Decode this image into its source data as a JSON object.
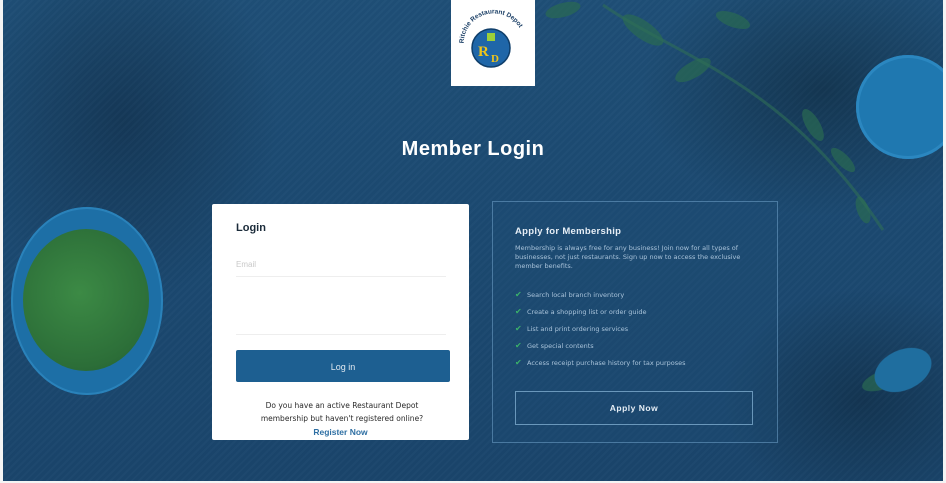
{
  "brand": {
    "logo_arc_text": "Ritchie Restaurant Depot",
    "logo_initials": "RD"
  },
  "page": {
    "title": "Member Login"
  },
  "login": {
    "heading": "Login",
    "email_placeholder": "Email",
    "password_placeholder": "",
    "button_label": "Log in",
    "note": "Do you have an active Restaurant Depot membership but haven't registered online?",
    "register_link": "Register Now"
  },
  "apply": {
    "heading": "Apply for Membership",
    "description": "Membership is always free for any business! Join now for all types of businesses, not just restaurants. Sign up now to access the exclusive member benefits.",
    "benefits": [
      "Search local branch inventory",
      "Create a shopping list or order guide",
      "List and print ordering services",
      "Get special contents",
      "Access receipt purchase history for tax purposes"
    ],
    "button_label": "Apply Now"
  },
  "colors": {
    "background": "#1c4a72",
    "primary_button": "#1d5f91",
    "link": "#2e6fa3",
    "check": "#3bb36a"
  },
  "icons": {
    "benefit_check": "check-icon",
    "logo": "restaurant-depot-logo"
  }
}
